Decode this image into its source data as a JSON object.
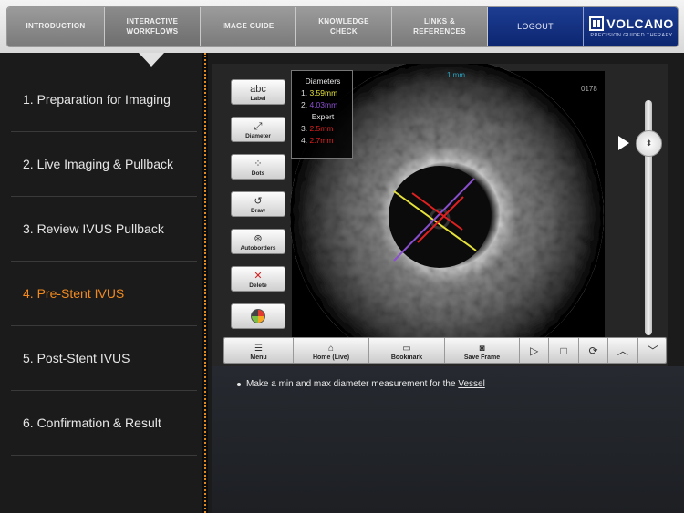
{
  "nav": {
    "items": [
      {
        "label": "INTRODUCTION"
      },
      {
        "label": "INTERACTIVE\nWORKFLOWS"
      },
      {
        "label": "IMAGE GUIDE"
      },
      {
        "label": "KNOWLEDGE\nCHECK"
      },
      {
        "label": "LINKS &\nREFERENCES"
      }
    ],
    "logout": "LOGOUT",
    "brand": {
      "name": "VOLCANO",
      "tagline": "PRECISION GUIDED THERAPY"
    }
  },
  "steps": [
    {
      "label": "1. Preparation for Imaging"
    },
    {
      "label": "2. Live Imaging & Pullback"
    },
    {
      "label": "3. Review IVUS Pullback"
    },
    {
      "label": "4. Pre-Stent IVUS"
    },
    {
      "label": "5. Post-Stent IVUS"
    },
    {
      "label": "6. Confirmation & Result"
    }
  ],
  "tools": [
    {
      "label": "Label",
      "icon": "text-label-icon"
    },
    {
      "label": "Diameter",
      "icon": "diameter-icon"
    },
    {
      "label": "Dots",
      "icon": "dots-icon"
    },
    {
      "label": "Draw",
      "icon": "draw-icon"
    },
    {
      "label": "Autoborders",
      "icon": "autoborders-icon"
    },
    {
      "label": "Delete",
      "icon": "delete-icon"
    },
    {
      "label": "",
      "icon": "color-wheel-icon"
    }
  ],
  "diameters": {
    "title": "Diameters",
    "user": [
      {
        "label": "1. ",
        "value": "3.59mm",
        "color": "#e6e23a"
      },
      {
        "label": "2. ",
        "value": "4.03mm",
        "color": "#8a4fd0"
      }
    ],
    "expert_title": "Expert",
    "expert": [
      {
        "label": "3. ",
        "value": "2.5mm",
        "color": "#e02020"
      },
      {
        "label": "4. ",
        "value": "2.7mm",
        "color": "#e02020"
      }
    ]
  },
  "image": {
    "scale_label": "1 mm",
    "frame_number": "0178"
  },
  "toolbar": {
    "buttons": [
      {
        "label": "Menu",
        "icon": "menu-icon"
      },
      {
        "label": "Home (Live)",
        "icon": "home-icon"
      },
      {
        "label": "Bookmark",
        "icon": "bookmark-icon"
      },
      {
        "label": "Save Frame",
        "icon": "camera-icon"
      }
    ],
    "controls": [
      "play-icon",
      "stop-icon",
      "loop-icon",
      "chevron-up-icon",
      "chevron-down-icon"
    ]
  },
  "instruction": {
    "text": "Make a min and max diameter measurement for the ",
    "link": "Vessel"
  },
  "colors": {
    "accent": "#f28a1e",
    "brand_blue": "#0c2670"
  }
}
